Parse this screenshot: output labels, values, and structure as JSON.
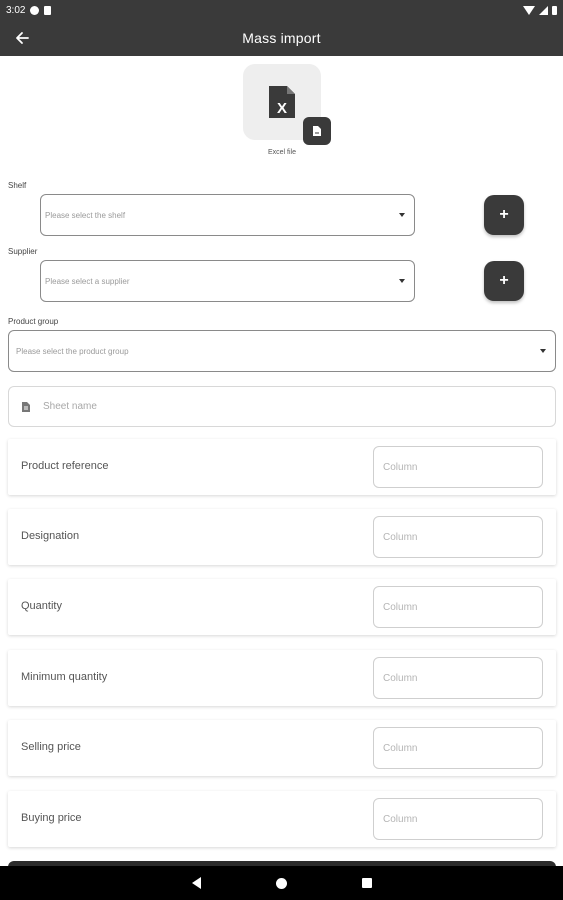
{
  "status_bar": {
    "time": "3:02"
  },
  "app_bar": {
    "title": "Mass import"
  },
  "file": {
    "label": "Excel file",
    "glyph": "X"
  },
  "shelf": {
    "label": "Shelf",
    "placeholder": "Please select the shelf",
    "add_label": "+"
  },
  "supplier": {
    "label": "Supplier",
    "placeholder": "Please select a supplier",
    "add_label": "+"
  },
  "product_group": {
    "label": "Product group",
    "placeholder": "Please select the product group"
  },
  "sheet": {
    "placeholder": "Sheet name"
  },
  "mappings": [
    {
      "label": "Product reference",
      "placeholder": "Column"
    },
    {
      "label": "Designation",
      "placeholder": "Column"
    },
    {
      "label": "Quantity",
      "placeholder": "Column"
    },
    {
      "label": "Minimum quantity",
      "placeholder": "Column"
    },
    {
      "label": "Selling price",
      "placeholder": "Column"
    },
    {
      "label": "Buying price",
      "placeholder": "Column"
    }
  ],
  "colors": {
    "bar": "#3a3a3a",
    "accent": "#3a3a3a",
    "nav": "#000000"
  },
  "icons": [
    "back-arrow-icon",
    "excel-file-icon",
    "file-badge-icon",
    "plus-icon",
    "dropdown-arrow-icon",
    "document-icon"
  ]
}
